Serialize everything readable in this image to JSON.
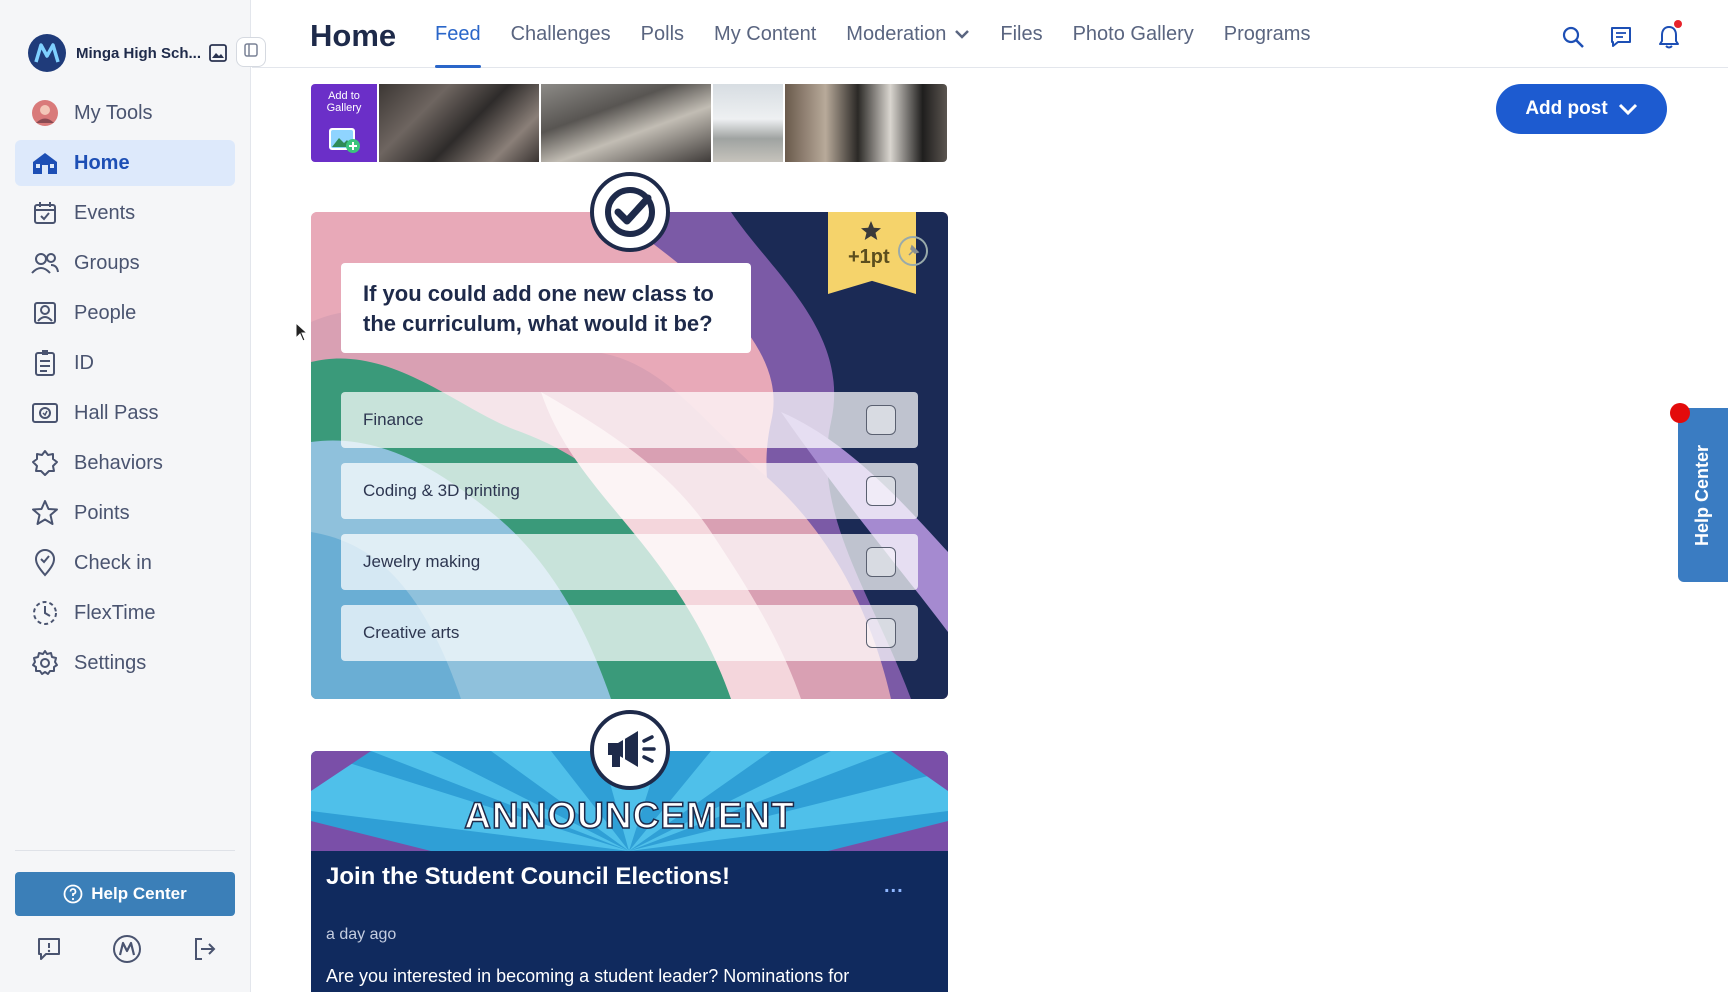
{
  "app": {
    "school_name": "Minga High Sch...",
    "page_title": "Home"
  },
  "sidebar": {
    "items": [
      {
        "label": "My Tools",
        "icon": "avatar-icon",
        "active": false
      },
      {
        "label": "Home",
        "icon": "home-icon",
        "active": true
      },
      {
        "label": "Events",
        "icon": "calendar-icon",
        "active": false
      },
      {
        "label": "Groups",
        "icon": "groups-icon",
        "active": false
      },
      {
        "label": "People",
        "icon": "people-icon",
        "active": false
      },
      {
        "label": "ID",
        "icon": "id-card-icon",
        "active": false
      },
      {
        "label": "Hall Pass",
        "icon": "hall-pass-icon",
        "active": false
      },
      {
        "label": "Behaviors",
        "icon": "behaviors-icon",
        "active": false
      },
      {
        "label": "Points",
        "icon": "star-icon",
        "active": false
      },
      {
        "label": "Check in",
        "icon": "check-in-icon",
        "active": false
      },
      {
        "label": "FlexTime",
        "icon": "flextime-icon",
        "active": false
      },
      {
        "label": "Settings",
        "icon": "gear-icon",
        "active": false
      }
    ],
    "help_label": "Help Center"
  },
  "topbar": {
    "tabs": [
      {
        "label": "Feed",
        "active": true
      },
      {
        "label": "Challenges",
        "active": false
      },
      {
        "label": "Polls",
        "active": false
      },
      {
        "label": "My Content",
        "active": false
      },
      {
        "label": "Moderation",
        "active": false,
        "dropdown": true
      },
      {
        "label": "Files",
        "active": false
      },
      {
        "label": "Photo Gallery",
        "active": false
      },
      {
        "label": "Programs",
        "active": false
      }
    ]
  },
  "actions": {
    "add_post_label": "Add post"
  },
  "gallery": {
    "add_label_line1": "Add to",
    "add_label_line2": "Gallery"
  },
  "poll": {
    "points": "+1pt",
    "question": "If you could add one new class to the curriculum, what would it be?",
    "options": [
      "Finance",
      "Coding & 3D printing",
      "Jewelry making",
      "Creative arts"
    ]
  },
  "announcement": {
    "banner_word": "ANNOUNCEMENT",
    "title": "Join the Student Council Elections!",
    "more": "...",
    "time": "a day ago",
    "body": "Are you interested in becoming a student leader? Nominations for"
  },
  "side_help": {
    "label": "Help Center"
  },
  "colors": {
    "primary": "#1d5bd0",
    "nav_active_bg": "#dde9fb",
    "help_button": "#3b7fb8",
    "announcement_bg": "#102a5e",
    "notification_dot": "#e8232b"
  }
}
